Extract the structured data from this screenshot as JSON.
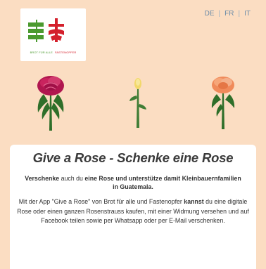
{
  "logo": {
    "caption_left": "BROT FÜR ALLE",
    "caption_right": "FASTENOPFER",
    "colors": {
      "green": "#4b9a2f",
      "red": "#d4202c"
    }
  },
  "languages": [
    "DE",
    "FR",
    "IT"
  ],
  "language_separator": "|",
  "roses": [
    {
      "name": "red-rose",
      "color": "#c2185b"
    },
    {
      "name": "yellow-rose",
      "color": "#f2d86a"
    },
    {
      "name": "orange-rose",
      "color": "#f39a6b"
    }
  ],
  "content": {
    "title": "Give a Rose - Schenke eine Rose",
    "lead": [
      {
        "text": "Verschenke",
        "bold": true
      },
      {
        "text": " auch du ",
        "bold": false
      },
      {
        "text": "eine Rose und unterstütze damit Kleinbauernfamilien in Guatemala.",
        "bold": true
      }
    ],
    "body": [
      {
        "text": "Mit der App \"Give a Rose\" von Brot für alle und Fastenopfer ",
        "bold": false
      },
      {
        "text": "kannst",
        "bold": true
      },
      {
        "text": " du eine digitale Rose oder einen ganzen Rosenstrauss kaufen, mit einer Widmung versehen und auf Facebook teilen sowie per Whatsapp oder per E-Mail verschenken.",
        "bold": false
      }
    ]
  },
  "colors": {
    "background": "#fbddc2",
    "card": "#ffffff",
    "link": "#6a8ba8"
  }
}
